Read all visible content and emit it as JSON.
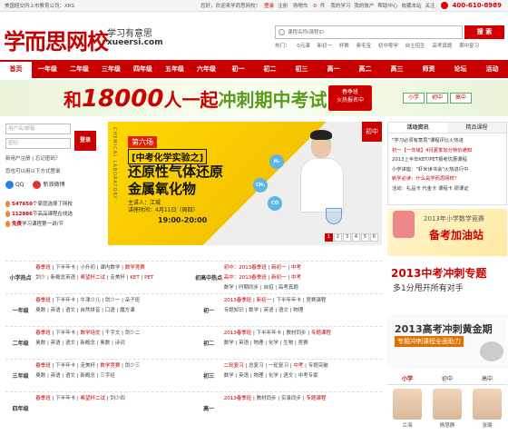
{
  "topbar": {
    "notice": "美国纽交所上市教育公司：XRS",
    "welcome": "您好，欢迎来学而思网校！",
    "login": "登录",
    "register": "注册",
    "cart": "购物车",
    "cart_count": "0",
    "items": "件",
    "my_study": "我的学习",
    "my_account": "我的账户",
    "help": "帮助中心",
    "favorite": "收藏本站",
    "follow": "关注",
    "phone": "400-610-8989"
  },
  "header": {
    "logo": "学而思网校",
    "slogan": "学习有意思",
    "domain": "xueersi.com",
    "search_placeholder": "课程名称/课程ID",
    "search_button": "搜 索",
    "hot_label": "热门：",
    "hot_words": [
      "0元课",
      "新初一",
      "杯赛",
      "奥毛宝",
      "初中零学",
      "自主招生",
      "高考真题",
      "期中复习"
    ]
  },
  "nav": [
    "首页",
    "一年级",
    "二年级",
    "三年级",
    "四年级",
    "五年级",
    "六年级",
    "初一",
    "初二",
    "初三",
    "高一",
    "高二",
    "高三",
    "师资",
    "论坛",
    "活动"
  ],
  "banner": {
    "pre": "和",
    "number": "18000",
    "mid": "人一起",
    "accent": "冲刺期中考试",
    "badge_line1": "春季班",
    "badge_line2": "火热报名中",
    "grade_buttons": [
      "小学",
      "初中",
      "高中"
    ]
  },
  "login": {
    "user_placeholder": "用户名/邮箱",
    "pass_placeholder": "密码",
    "button": "登录",
    "register": "新用户注册",
    "forgot": "忘记密码？",
    "alt_login": "您也可以用以下方式登录",
    "qq": "QQ",
    "weibo": "新浪微博",
    "stats": [
      {
        "num": "547650",
        "text": "个家庭选择了网校"
      },
      {
        "num": "112886",
        "text": "节高品课程在线选"
      },
      {
        "num": "免费",
        "text": "学习课程第一讲/节"
      }
    ]
  },
  "slide": {
    "vert": "CHEMICAL LABORATORY",
    "tag": "第六场",
    "sub": "[中考化学实验之]",
    "title_l1": "还原性气体还原",
    "title_l2": "金属氧化物",
    "teacher": "主讲人：江城",
    "date": "讲座时间：4月11日（周四）",
    "time": "19:00-20:00",
    "corner": "初中",
    "chem": [
      "H₂",
      "CH₄",
      "CO"
    ],
    "pages": [
      "1",
      "2",
      "3",
      "4",
      "5",
      "6"
    ],
    "current_page": "1"
  },
  "news": {
    "tabs": [
      "活动资讯",
      "精品课程"
    ],
    "items": [
      {
        "text": "\"学习必须有意思\"课程评比火热进",
        "hot": false
      },
      {
        "text": "初一【一年级】4月夏季加分特价通知",
        "hot": true
      },
      {
        "text": "2013上半年KET/PET报考优惠课程",
        "hot": false
      },
      {
        "text": "小学讲座：\"虾米读书会\"火热进行中",
        "hot": false
      },
      {
        "text": "新学必读：什么是学而思网校？",
        "hot": true
      },
      {
        "text": "活动：礼品卡 代金卡 课程卡 研课证",
        "hot": false
      }
    ]
  },
  "ads": {
    "ad1_a": "2013年小学数学竞赛",
    "ad1_b": "备考加油站",
    "ad2_a": "2013中考冲刺专题",
    "ad2_b": "多1分甩开所有对手",
    "ad3_a": "2013高考冲刺黄金期",
    "ad3_b": "专题冲刺课程全面助力"
  },
  "teach": {
    "tabs": [
      "小学",
      "初中",
      "高中"
    ],
    "names": [
      "兰海",
      "杨慧静",
      "张璐"
    ]
  },
  "grid": {
    "rows": [
      {
        "label_l": "小学热点",
        "left": [
          [
            "春季班",
            "下半年卡",
            "小升初",
            "课内数学",
            "数学竞赛"
          ],
          [
            "剑少",
            "新概念英语",
            "希望杯二试",
            "走美杯",
            "KET",
            "PET"
          ]
        ],
        "label_r": "初高中热点",
        "right": [
          [
            "初中：2013春季班",
            "新初一",
            "中考"
          ],
          [
            "高中：2013春季班",
            "新初一",
            "中考"
          ],
          [
            "数学",
            "时期同步",
            "自招",
            "高考真题"
          ]
        ]
      },
      {
        "label_l": "一年级",
        "left": [
          [
            "春季班",
            "下半年卡",
            "牛津少儿",
            "剑少一",
            "朵子班"
          ],
          [
            "奥数",
            "英语",
            "语文",
            "自然拼音",
            "口语",
            "魔方课"
          ]
        ],
        "label_r": "初一",
        "right": [
          [
            "2013春季班",
            "新初一",
            "下半年年卡",
            "竞赛课程"
          ],
          [
            "专题知识",
            "数学",
            "英语",
            "语文",
            "物理"
          ]
        ]
      },
      {
        "label_l": "二年级",
        "left": [
          [
            "春季班",
            "下半年卡",
            "数学培优",
            "千字文",
            "剑少二"
          ],
          [
            "奥数",
            "英语",
            "语文",
            "新概念",
            "奥数",
            "诗词"
          ]
        ],
        "label_r": "初二",
        "right": [
          [
            "2013春季班",
            "下半年年卡",
            "教材同步",
            "专题课程"
          ],
          [
            "数学",
            "英语",
            "物理",
            "化学",
            "生物",
            "竞赛"
          ]
        ]
      },
      {
        "label_l": "三年级",
        "left": [
          [
            "春季班",
            "下半年卡",
            "走美杯",
            "数学竞赛",
            "剑少三"
          ],
          [
            "奥数",
            "英语",
            "语文",
            "新概念",
            "三字经"
          ]
        ],
        "label_r": "初三",
        "right": [
          [
            "二轮复习",
            "总复习",
            "一轮复习",
            "中考",
            "专题突破"
          ],
          [
            "数学",
            "英语",
            "物理",
            "化学",
            "语文",
            "中考专家"
          ]
        ]
      },
      {
        "label_l": "四年级",
        "left": [
          [
            "春季班",
            "下半年卡",
            "希望杯二试",
            "剑少四"
          ],
          []
        ],
        "label_r": "高一",
        "right": [
          [
            "2013春季班",
            "教材同步",
            "实录同步",
            "专题课程"
          ],
          []
        ]
      }
    ]
  }
}
